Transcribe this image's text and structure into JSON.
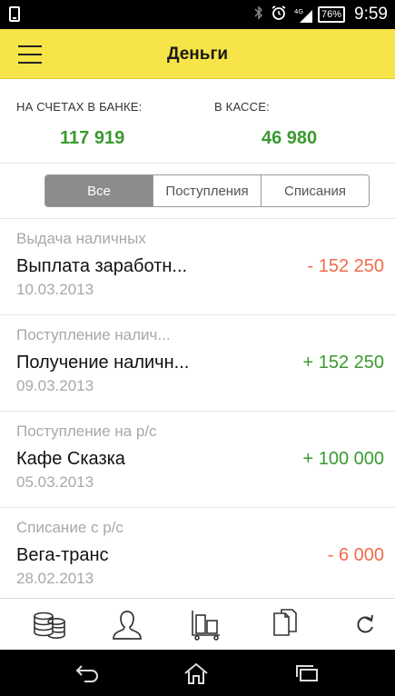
{
  "status_bar": {
    "network": "4G",
    "battery": "76%",
    "time": "9:59"
  },
  "header": {
    "title": "Деньги"
  },
  "summary": {
    "bank_label": "НА СЧЕТАХ В БАНКЕ:",
    "bank_value": "117 919",
    "cash_label": "В КАССЕ:",
    "cash_value": "46 980"
  },
  "filters": {
    "all": "Все",
    "income": "Поступления",
    "outgo": "Списания",
    "selected": "Все"
  },
  "transactions": [
    {
      "type": "Выдача наличных",
      "name": "Выплата заработн...",
      "date": "10.03.2013",
      "amount": "- 152 250",
      "sign": "negative"
    },
    {
      "type": "Поступление налич...",
      "name": "Получение наличн...",
      "date": "09.03.2013",
      "amount": "+ 152 250",
      "sign": "positive"
    },
    {
      "type": "Поступление на р/с",
      "name": "Кафе Сказка",
      "date": "05.03.2013",
      "amount": "+ 100 000",
      "sign": "positive"
    },
    {
      "type": "Списание с р/с",
      "name": "Вега-транс",
      "date": "28.02.2013",
      "amount": "- 6 000",
      "sign": "negative"
    }
  ],
  "colors": {
    "header_bg": "#f7e448",
    "positive": "#3a9a2f",
    "negative": "#f06b4a",
    "selected_segment": "#8c8c8c"
  },
  "tabbar_icons": [
    "coins-icon",
    "person-icon",
    "warehouse-cart-icon",
    "documents-icon",
    "refresh-icon"
  ],
  "navbar_icons": [
    "back-icon",
    "home-icon",
    "recent-apps-icon"
  ]
}
